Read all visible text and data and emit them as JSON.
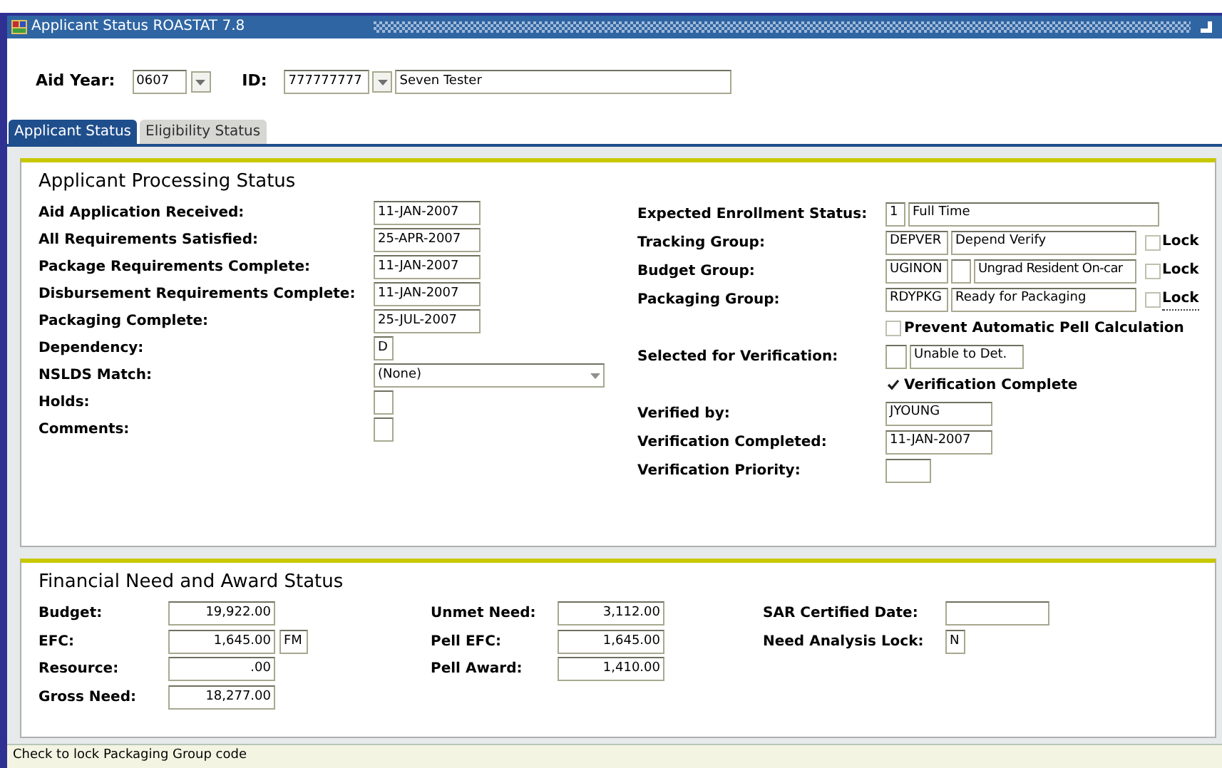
{
  "window": {
    "title": "Applicant Status  ROASTAT  7.8"
  },
  "key_block": {
    "aid_year": {
      "label": "Aid Year:",
      "value": "0607"
    },
    "id": {
      "label": "ID:",
      "value": "777777777",
      "name": "Seven Tester"
    }
  },
  "tabs": [
    {
      "label": "Applicant Status",
      "selected": true
    },
    {
      "label": "Eligibility Status",
      "selected": false
    }
  ],
  "processing": {
    "title": "Applicant Processing Status",
    "left_fields": [
      {
        "label": "Aid Application Received:",
        "kind": "date",
        "value": "11-JAN-2007"
      },
      {
        "label": "All Requirements Satisfied:",
        "kind": "date",
        "value": "25-APR-2007"
      },
      {
        "label": "Package Requirements Complete:",
        "kind": "date",
        "value": "11-JAN-2007"
      },
      {
        "label": "Disbursement Requirements Complete:",
        "kind": "date",
        "value": "11-JAN-2007"
      },
      {
        "label": "Packaging Complete:",
        "kind": "date",
        "value": "25-JUL-2007"
      },
      {
        "label": "Dependency:",
        "kind": "char",
        "value": "D"
      },
      {
        "label": "NSLDS Match:",
        "kind": "select",
        "value": "(None)"
      },
      {
        "label": "Holds:",
        "kind": "flag"
      },
      {
        "label": "Comments:",
        "kind": "flag"
      }
    ],
    "right_fields": [
      {
        "label": "Expected Enrollment Status:",
        "kind": "code_desc",
        "code": "1",
        "desc": "Full Time"
      },
      {
        "label": "Tracking Group:",
        "kind": "code_desc",
        "code": "DEPVER",
        "desc": "Depend Verify",
        "lock": {
          "label": "Lock",
          "checked": false,
          "focused": false
        }
      },
      {
        "label": "Budget Group:",
        "kind": "code_desc",
        "code": "UGINON",
        "extra_box": true,
        "desc": "Ungrad Resident On-car",
        "lock": {
          "label": "Lock",
          "checked": false,
          "focused": false
        }
      },
      {
        "label": "Packaging Group:",
        "kind": "code_desc",
        "code": "RDYPKG",
        "desc": "Ready for Packaging",
        "lock": {
          "label": "Lock",
          "checked": false,
          "focused": true
        }
      },
      {
        "kind": "checkbox",
        "label": "Prevent Automatic Pell Calculation",
        "checked": false
      },
      {
        "label": "Selected for Verification:",
        "kind": "flag_desc",
        "desc": "Unable to Det."
      },
      {
        "kind": "checkbox",
        "label": "Verification Complete",
        "checked": true
      },
      {
        "label": "Verified by:",
        "kind": "text",
        "value": "JYOUNG"
      },
      {
        "label": "Verification Completed:",
        "kind": "date",
        "value": "11-JAN-2007"
      },
      {
        "label": "Verification Priority:",
        "kind": "short"
      }
    ]
  },
  "financial": {
    "title": "Financial Need and Award Status",
    "columns": [
      [
        {
          "label": "Budget:",
          "value": "19,922.00"
        },
        {
          "label": "EFC:",
          "value": "1,645.00",
          "suffix": "FM"
        },
        {
          "label": "Resource:",
          "value": ".00"
        },
        {
          "label": "Gross Need:",
          "value": "18,277.00"
        }
      ],
      [
        {
          "label": "Unmet Need:",
          "value": "3,112.00"
        },
        {
          "label": "Pell EFC:",
          "value": "1,645.00"
        },
        {
          "label": "Pell Award:",
          "value": "1,410.00"
        }
      ],
      [
        {
          "label": "SAR Certified Date:",
          "kind": "date"
        },
        {
          "label": "Need Analysis Lock:",
          "kind": "char",
          "value": "N"
        }
      ]
    ]
  },
  "status_bar": "Check to lock Packaging Group code"
}
